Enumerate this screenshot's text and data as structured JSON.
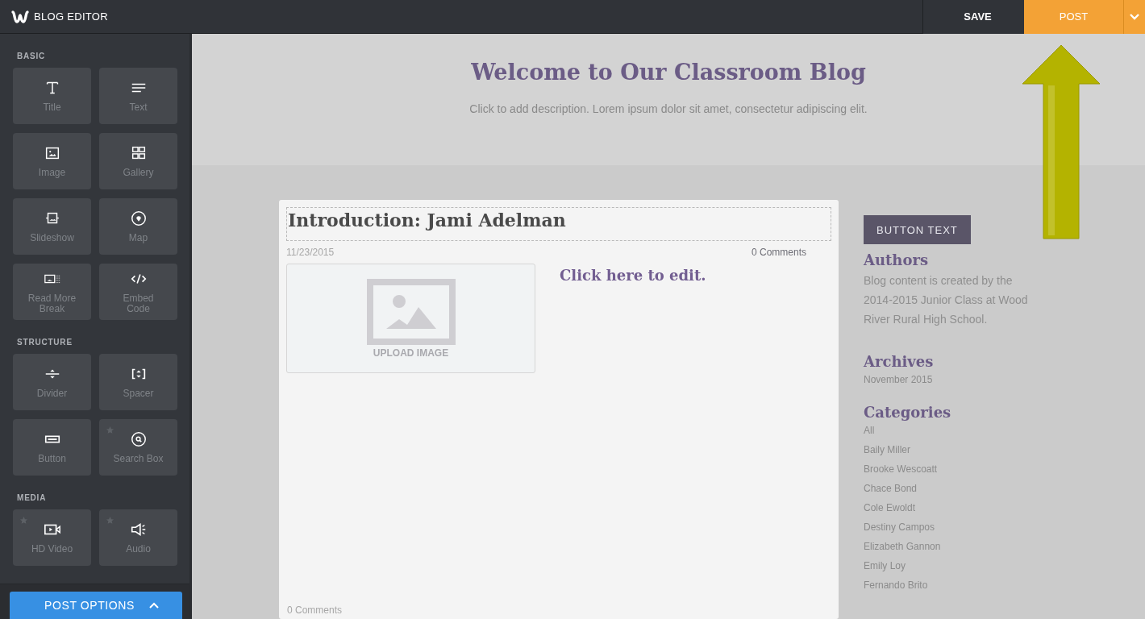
{
  "topbar": {
    "title": "BLOG EDITOR",
    "save": "SAVE",
    "post": "POST"
  },
  "sidebar": {
    "sections": [
      {
        "label": "BASIC",
        "items": [
          {
            "kind": "title",
            "label": "Title",
            "starred": false
          },
          {
            "kind": "text",
            "label": "Text",
            "starred": false
          },
          {
            "kind": "image",
            "label": "Image",
            "starred": false
          },
          {
            "kind": "gallery",
            "label": "Gallery",
            "starred": false
          },
          {
            "kind": "slideshow",
            "label": "Slideshow",
            "starred": false
          },
          {
            "kind": "map",
            "label": "Map",
            "starred": false
          },
          {
            "kind": "readmore",
            "label": "Read More Break",
            "starred": false
          },
          {
            "kind": "embed",
            "label": "Embed Code",
            "starred": false
          }
        ]
      },
      {
        "label": "STRUCTURE",
        "items": [
          {
            "kind": "divider",
            "label": "Divider",
            "starred": false
          },
          {
            "kind": "spacer",
            "label": "Spacer",
            "starred": false
          },
          {
            "kind": "button",
            "label": "Button",
            "starred": false
          },
          {
            "kind": "search",
            "label": "Search Box",
            "starred": true
          }
        ]
      },
      {
        "label": "MEDIA",
        "items": [
          {
            "kind": "video",
            "label": "HD Video",
            "starred": true
          },
          {
            "kind": "audio",
            "label": "Audio",
            "starred": true
          }
        ]
      }
    ],
    "post_options": "POST OPTIONS"
  },
  "header": {
    "title": "Welcome to Our Classroom Blog",
    "description": "Click to add description. Lorem ipsum dolor sit amet, consectetur adipiscing elit."
  },
  "post": {
    "title": "Introduction: Jami Adelman",
    "date": "11/23/2015",
    "comments": "0 Comments",
    "upload": "UPLOAD IMAGE",
    "body": "Click here to edit.",
    "footer_comments": "0 Comments"
  },
  "aside": {
    "button": "BUTTON TEXT",
    "authors_title": "Authors",
    "authors_text": "Blog content is created by the 2014-2015 Junior Class at Wood River Rural High School.",
    "archives_title": "Archives",
    "archives": [
      "November 2015"
    ],
    "categories_title": "Categories",
    "categories": [
      "All",
      "Baily Miller",
      "Brooke Wescoatt",
      "Chace Bond",
      "Cole Ewoldt",
      "Destiny Campos",
      "Elizabeth Gannon",
      "Emily Loy",
      "Fernando Brito"
    ]
  }
}
